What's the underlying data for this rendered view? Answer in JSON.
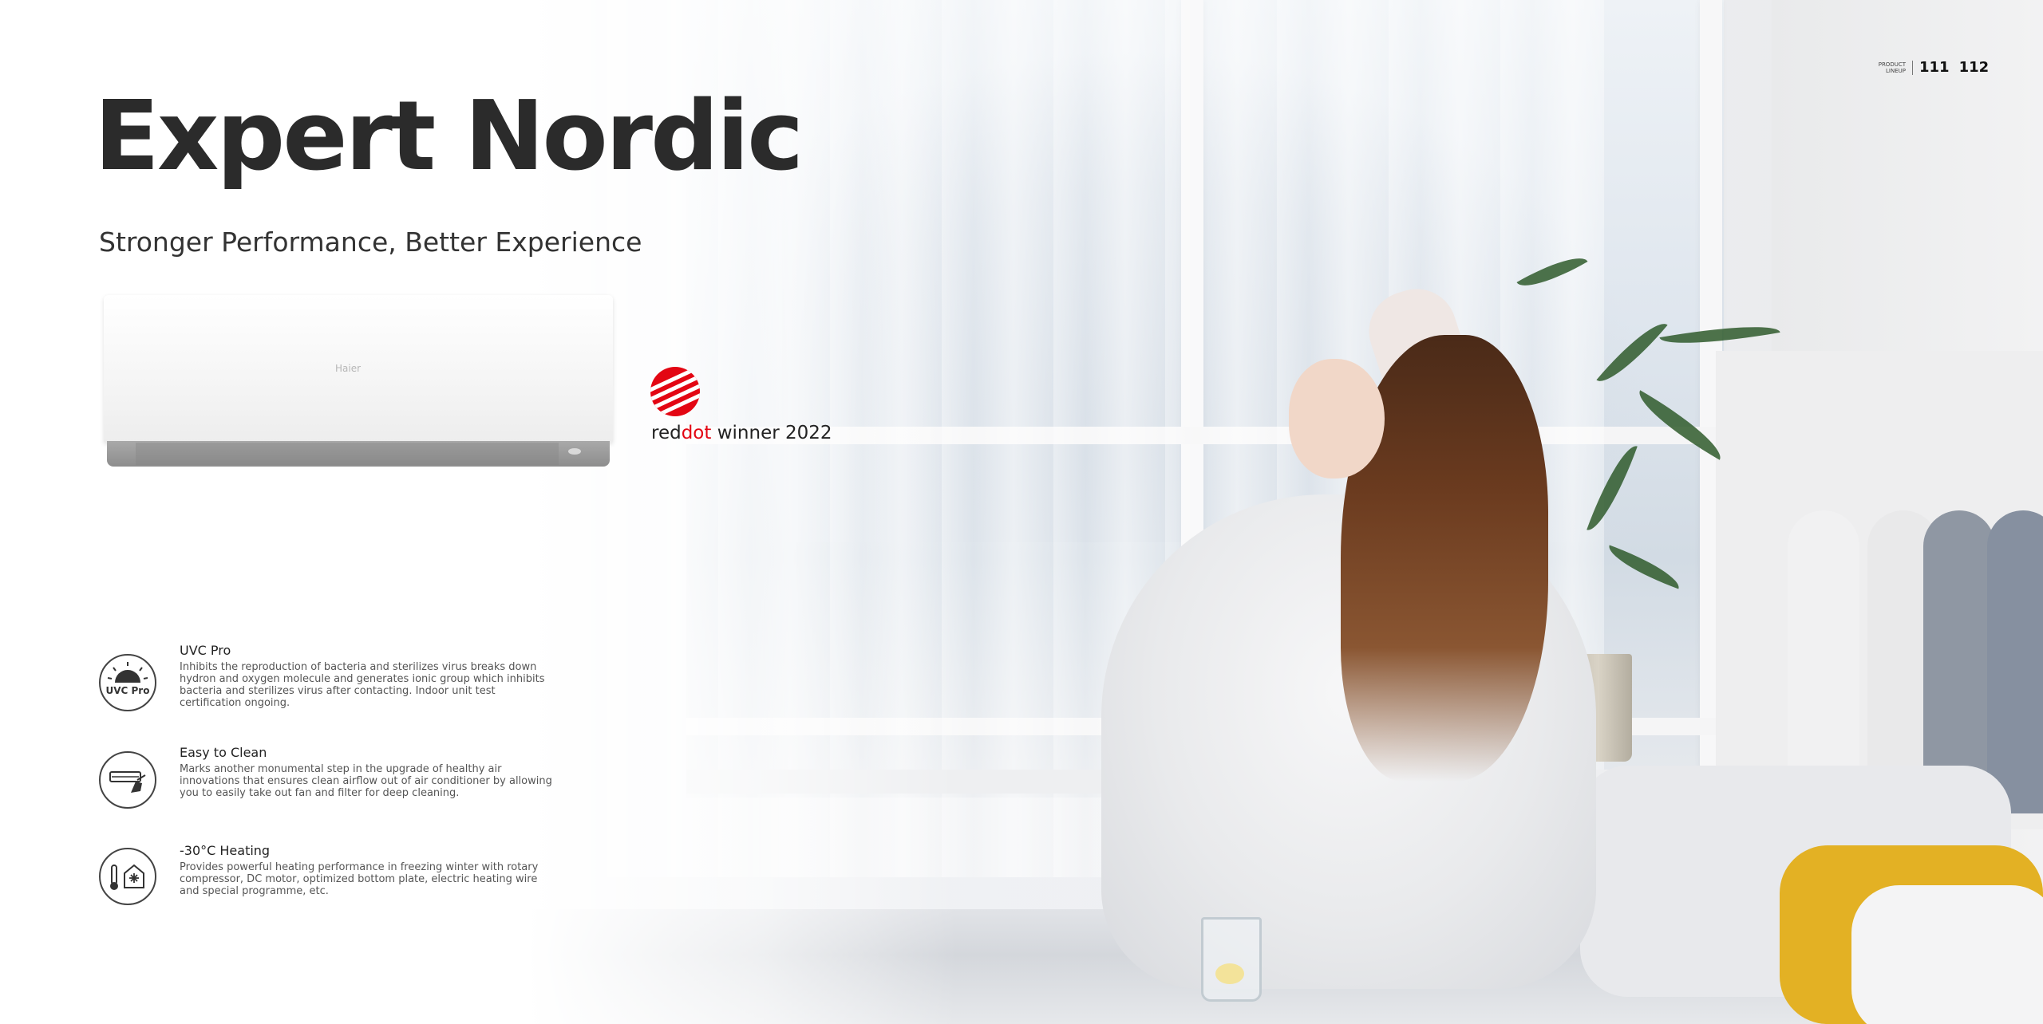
{
  "page": {
    "title": "Expert Nordic",
    "subtitle": "Stronger Performance, Better Experience",
    "pager": {
      "label_line1": "PRODUCT",
      "label_line2": "LINEUP",
      "pages": [
        "111",
        "112"
      ]
    }
  },
  "product": {
    "brand_mark": "Haier"
  },
  "award": {
    "red_word": "dot",
    "prefix": "red",
    "suffix": " winner 2022"
  },
  "features": [
    {
      "icon": "uvc-pro-icon",
      "icon_text": "UVC Pro",
      "title": "UVC Pro",
      "description": "Inhibits the reproduction of bacteria and sterilizes virus breaks down hydron and oxygen molecule and generates ionic group which inhibits bacteria and sterilizes virus after contacting. Indoor unit test certification ongoing."
    },
    {
      "icon": "easy-clean-icon",
      "title": "Easy to Clean",
      "description": "Marks another monumental step in the upgrade of healthy air innovations that ensures clean airflow out of air conditioner by allowing you to easily take out fan and filter for deep cleaning."
    },
    {
      "icon": "heating-icon",
      "title": "-30°C Heating",
      "description": "Provides powerful heating performance in freezing winter with rotary compressor, DC motor, optimized bottom plate, electric heating wire and special programme, etc."
    }
  ],
  "colors": {
    "accent": "#e30613",
    "text": "#2b2b2b"
  }
}
